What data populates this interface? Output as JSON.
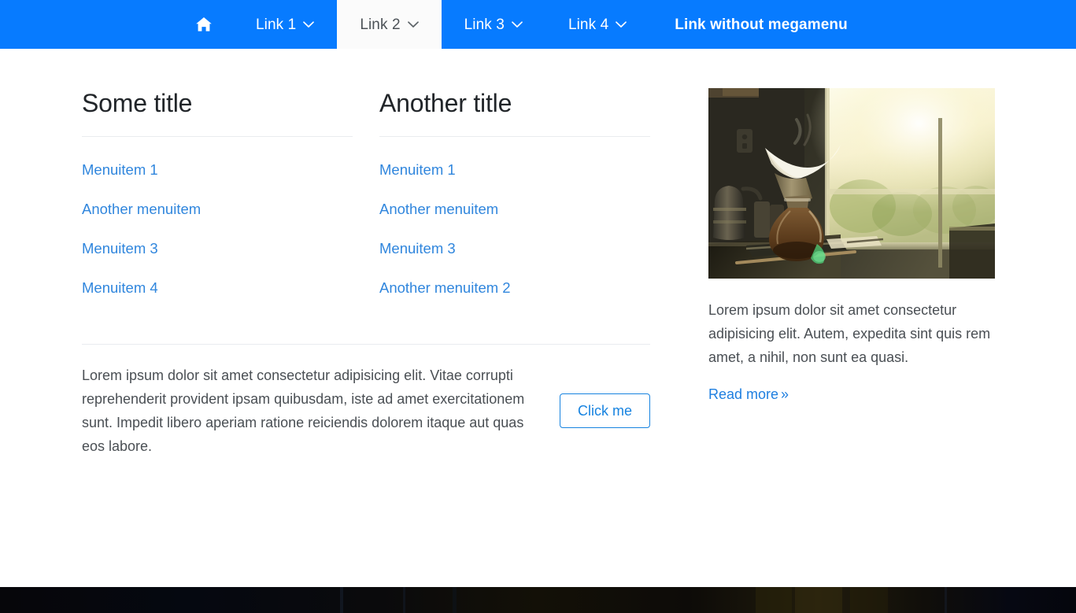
{
  "navbar": {
    "background_color": "#077bff",
    "active_tab_background": "#fbfbfb",
    "home_icon": "home-icon",
    "items": [
      {
        "label": "",
        "icon": "home-icon",
        "has_caret": false,
        "active": false
      },
      {
        "label": "Link 1",
        "icon": "chevron-down-icon",
        "has_caret": true,
        "active": false
      },
      {
        "label": "Link 2",
        "icon": "chevron-down-icon",
        "has_caret": true,
        "active": true
      },
      {
        "label": "Link 3",
        "icon": "chevron-down-icon",
        "has_caret": true,
        "active": false
      },
      {
        "label": "Link 4",
        "icon": "chevron-down-icon",
        "has_caret": true,
        "active": false
      },
      {
        "label": "Link without megamenu",
        "icon": "",
        "has_caret": false,
        "active": false
      }
    ]
  },
  "megamenu": {
    "columns": {
      "first": {
        "title": "Some title",
        "links": [
          "Menuitem 1",
          "Another menuitem",
          "Menuitem 3",
          "Menuitem 4"
        ]
      },
      "second": {
        "title": "Another title",
        "links": [
          "Menuitem 1",
          "Another menuitem",
          "Menuitem 3",
          "Another menuitem 2"
        ]
      },
      "third": {
        "image_alt": "chemex-coffee-brewer-on-counter-by-sunlit-window",
        "paragraph": "Lorem ipsum dolor sit amet consectetur adipisicing elit. Autem, expedita sint quis rem amet, a nihil, non sunt ea quasi.",
        "read_more_label": "Read more",
        "read_more_chevron": "»"
      }
    },
    "footer": {
      "paragraph": "Lorem ipsum dolor sit amet consectetur adipisicing elit. Vitae corrupti reprehenderit provident ipsam quibusdam, iste ad amet exercitationem sunt. Impedit libero aperiam ratione reiciendis dolorem itaque aut quas eos labore.",
      "button_label": "Click me"
    }
  },
  "colors": {
    "primary_blue": "#077bff",
    "link_blue": "#3086dd",
    "button_blue": "#1783e0",
    "heading": "#212529",
    "body_text": "#4a4f54",
    "divider": "#e9ecef"
  }
}
